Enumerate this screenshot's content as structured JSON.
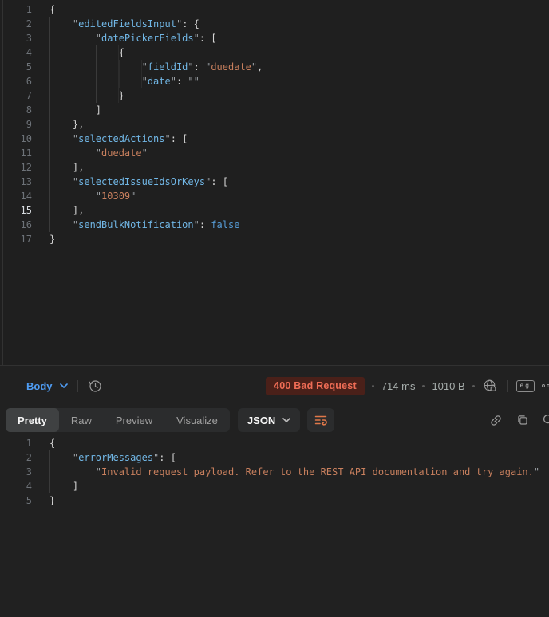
{
  "colors": {
    "background": "#212121",
    "accent_blue": "#4f9df4",
    "badge_bg": "#4a2019",
    "badge_text": "#ef6c55",
    "syntax_key": "#71b7e6",
    "syntax_string": "#c9805e",
    "syntax_keyword": "#569cd6",
    "beautify_orange": "#e0784a"
  },
  "request_editor": {
    "language": "json",
    "active_line": 15,
    "lines": [
      {
        "n": 1,
        "i": 0,
        "tk": [
          [
            "p",
            "{"
          ]
        ]
      },
      {
        "n": 2,
        "i": 4,
        "tk": [
          [
            "q",
            "\""
          ],
          [
            "k",
            "editedFieldsInput"
          ],
          [
            "q",
            "\""
          ],
          [
            "p",
            ": {"
          ]
        ]
      },
      {
        "n": 3,
        "i": 8,
        "tk": [
          [
            "q",
            "\""
          ],
          [
            "k",
            "datePickerFields"
          ],
          [
            "q",
            "\""
          ],
          [
            "p",
            ": ["
          ]
        ]
      },
      {
        "n": 4,
        "i": 12,
        "tk": [
          [
            "p",
            "{"
          ]
        ]
      },
      {
        "n": 5,
        "i": 16,
        "tk": [
          [
            "q",
            "\""
          ],
          [
            "k",
            "fieldId"
          ],
          [
            "q",
            "\""
          ],
          [
            "p",
            ": "
          ],
          [
            "q",
            "\""
          ],
          [
            "s",
            "duedate"
          ],
          [
            "q",
            "\""
          ],
          [
            "p",
            ","
          ]
        ]
      },
      {
        "n": 6,
        "i": 16,
        "tk": [
          [
            "q",
            "\""
          ],
          [
            "k",
            "date"
          ],
          [
            "q",
            "\""
          ],
          [
            "p",
            ": "
          ],
          [
            "q",
            "\""
          ],
          [
            "q",
            "\""
          ]
        ]
      },
      {
        "n": 7,
        "i": 12,
        "tk": [
          [
            "p",
            "}"
          ]
        ]
      },
      {
        "n": 8,
        "i": 8,
        "tk": [
          [
            "p",
            "]"
          ]
        ]
      },
      {
        "n": 9,
        "i": 4,
        "tk": [
          [
            "p",
            "},"
          ]
        ]
      },
      {
        "n": 10,
        "i": 4,
        "tk": [
          [
            "q",
            "\""
          ],
          [
            "k",
            "selectedActions"
          ],
          [
            "q",
            "\""
          ],
          [
            "p",
            ": ["
          ]
        ]
      },
      {
        "n": 11,
        "i": 8,
        "tk": [
          [
            "q",
            "\""
          ],
          [
            "s",
            "duedate"
          ],
          [
            "q",
            "\""
          ]
        ]
      },
      {
        "n": 12,
        "i": 4,
        "tk": [
          [
            "p",
            "],"
          ]
        ]
      },
      {
        "n": 13,
        "i": 4,
        "tk": [
          [
            "q",
            "\""
          ],
          [
            "k",
            "selectedIssueIdsOrKeys"
          ],
          [
            "q",
            "\""
          ],
          [
            "p",
            ": ["
          ]
        ]
      },
      {
        "n": 14,
        "i": 8,
        "tk": [
          [
            "q",
            "\""
          ],
          [
            "s",
            "10309"
          ],
          [
            "q",
            "\""
          ]
        ]
      },
      {
        "n": 15,
        "i": 4,
        "tk": [
          [
            "p",
            "],"
          ]
        ]
      },
      {
        "n": 16,
        "i": 4,
        "tk": [
          [
            "q",
            "\""
          ],
          [
            "k",
            "sendBulkNotification"
          ],
          [
            "q",
            "\""
          ],
          [
            "p",
            ": "
          ],
          [
            "w",
            "false"
          ]
        ]
      },
      {
        "n": 17,
        "i": 0,
        "tk": [
          [
            "p",
            "}"
          ]
        ]
      }
    ]
  },
  "response_meta": {
    "body_label": "Body",
    "status": "400 Bad Request",
    "time": "714 ms",
    "size": "1010 B",
    "example_icon_label": "e.g."
  },
  "response_toolbar": {
    "tabs": [
      "Pretty",
      "Raw",
      "Preview",
      "Visualize"
    ],
    "active_tab": "Pretty",
    "format": "JSON"
  },
  "response_editor": {
    "language": "json",
    "lines": [
      {
        "n": 1,
        "i": 0,
        "tk": [
          [
            "p",
            "{"
          ]
        ]
      },
      {
        "n": 2,
        "i": 4,
        "tk": [
          [
            "q",
            "\""
          ],
          [
            "k",
            "errorMessages"
          ],
          [
            "q",
            "\""
          ],
          [
            "p",
            ": ["
          ]
        ]
      },
      {
        "n": 3,
        "i": 8,
        "tk": [
          [
            "q",
            "\""
          ],
          [
            "s",
            "Invalid request payload. Refer to the REST API documentation and try again."
          ],
          [
            "q",
            "\""
          ]
        ]
      },
      {
        "n": 4,
        "i": 4,
        "tk": [
          [
            "p",
            "]"
          ]
        ]
      },
      {
        "n": 5,
        "i": 0,
        "tk": [
          [
            "p",
            "}"
          ]
        ]
      }
    ]
  }
}
